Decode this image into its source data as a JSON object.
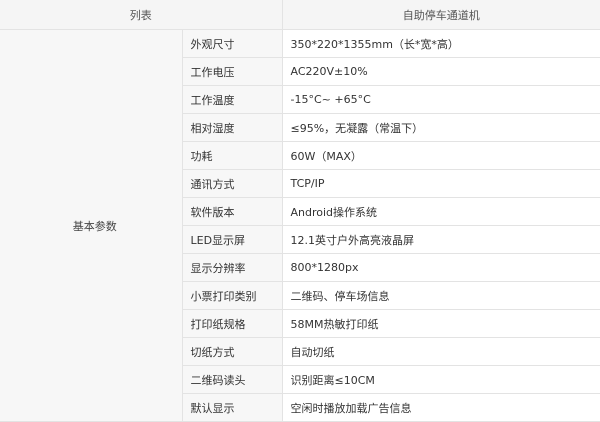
{
  "header": {
    "col1": "列表",
    "col2": "自助停车通道机"
  },
  "group": "基本参数",
  "rows": [
    {
      "name": "外观尺寸",
      "value": "350*220*1355mm（长*宽*高）"
    },
    {
      "name": "工作电压",
      "value": "AC220V±10%"
    },
    {
      "name": "工作温度",
      "value": "-15°C~ +65°C"
    },
    {
      "name": "相对湿度",
      "value": "≤95%，无凝露（常温下）"
    },
    {
      "name": "功耗",
      "value": "60W（MAX）"
    },
    {
      "name": "通讯方式",
      "value": "TCP/IP"
    },
    {
      "name": "软件版本",
      "value": "Android操作系统"
    },
    {
      "name": "LED显示屏",
      "value": "12.1英寸户外高亮液晶屏"
    },
    {
      "name": "显示分辨率",
      "value": "800*1280px"
    },
    {
      "name": "小票打印类别",
      "value": "二维码、停车场信息"
    },
    {
      "name": "打印纸规格",
      "value": "58MM热敏打印纸"
    },
    {
      "name": "切纸方式",
      "value": "自动切纸"
    },
    {
      "name": "二维码读头",
      "value": "识别距离≤10CM"
    },
    {
      "name": "默认显示",
      "value": "空闲时播放加载广告信息"
    }
  ]
}
